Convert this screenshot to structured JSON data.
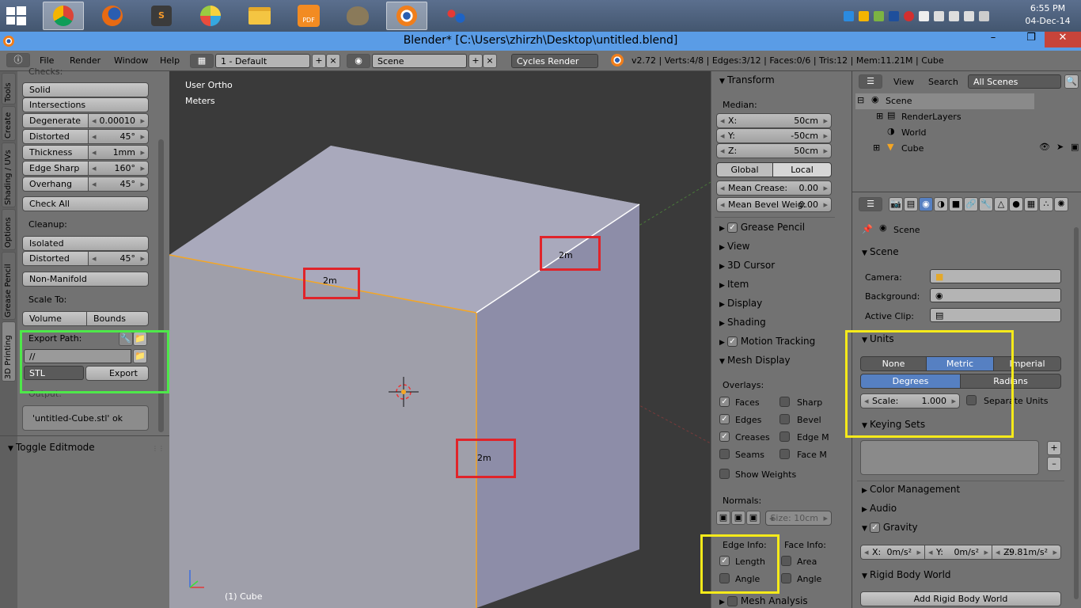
{
  "clock": {
    "time": "6:55 PM",
    "date": "04-Dec-14"
  },
  "window": {
    "title": "Blender* [C:\\Users\\zhirzh\\Desktop\\untitled.blend]"
  },
  "menu": {
    "items": [
      "File",
      "Render",
      "Window",
      "Help"
    ],
    "layout": "1 - Default",
    "scene": "Scene",
    "engine": "Cycles Render",
    "stats": "v2.72 | Verts:4/8 | Edges:3/12 | Faces:0/6 | Tris:12 | Mem:11.21M | Cube"
  },
  "left_tabs": [
    "Tools",
    "Create",
    "Shading / UVs",
    "Options",
    "Grease Pencil",
    "3D Printing"
  ],
  "toolshelf": {
    "checks_label": "Checks:",
    "solid": "Solid",
    "intersections": "Intersections",
    "degenerate": "Degenerate",
    "degenerate_val": "0.00010",
    "distorted": "Distorted",
    "distorted_val": "45°",
    "thickness": "Thickness",
    "thickness_val": "1mm",
    "edge_sharp": "Edge Sharp",
    "edge_sharp_val": "160°",
    "overhang": "Overhang",
    "overhang_val": "45°",
    "check_all": "Check All",
    "cleanup": "Cleanup:",
    "isolated": "Isolated",
    "distorted2": "Distorted",
    "distorted2_val": "45°",
    "non_manifold": "Non-Manifold",
    "scale_to": "Scale To:",
    "volume": "Volume",
    "bounds": "Bounds",
    "export_path": "Export Path:",
    "path_val": "//",
    "format": "STL",
    "export": "Export",
    "output": "Output:",
    "output_msg": "'untitled-Cube.stl' ok",
    "toggle_editmode": "Toggle Editmode"
  },
  "viewport": {
    "view_name": "User Ortho",
    "units": "Meters",
    "object": "(1) Cube",
    "dim_labels": [
      "2m",
      "2m",
      "2m"
    ]
  },
  "props": {
    "transform": "Transform",
    "median": "Median:",
    "x_label": "X:",
    "x_val": "50cm",
    "y_label": "Y:",
    "y_val": "-50cm",
    "z_label": "Z:",
    "z_val": "50cm",
    "global": "Global",
    "local": "Local",
    "mean_crease": "Mean Crease:",
    "mean_crease_val": "0.00",
    "mean_bevel": "Mean Bevel Weig:",
    "mean_bevel_val": "0.00",
    "grease_pencil": "Grease Pencil",
    "view": "View",
    "cursor": "3D Cursor",
    "item": "Item",
    "display": "Display",
    "shading": "Shading",
    "motion_tracking": "Motion Tracking",
    "mesh_display": "Mesh Display",
    "overlays": "Overlays:",
    "faces": "Faces",
    "sharp": "Sharp",
    "edges": "Edges",
    "bevel": "Bevel",
    "creases": "Creases",
    "edge_m": "Edge M",
    "seams": "Seams",
    "face_m": "Face M",
    "show_weights": "Show Weights",
    "normals": "Normals:",
    "size": "Size: 10cm",
    "edge_info": "Edge Info:",
    "face_info": "Face Info:",
    "length": "Length",
    "area": "Area",
    "angle": "Angle",
    "angle2": "Angle",
    "mesh_analysis": "Mesh Analysis"
  },
  "outliner": {
    "view": "View",
    "search": "Search",
    "filter": "All Scenes",
    "items": [
      "Scene",
      "RenderLayers",
      "World",
      "Cube"
    ]
  },
  "properties": {
    "breadcrumb": "Scene",
    "scene_hdr": "Scene",
    "camera": "Camera:",
    "background": "Background:",
    "active_clip": "Active Clip:",
    "units_hdr": "Units",
    "none": "None",
    "metric": "Metric",
    "imperial": "Imperial",
    "degrees": "Degrees",
    "radians": "Radians",
    "scale_label": "Scale:",
    "scale_val": "1.000",
    "separate_units": "Separate Units",
    "keying_sets": "Keying Sets",
    "color_mgmt": "Color Management",
    "audio": "Audio",
    "gravity": "Gravity",
    "gx_label": "X:",
    "gx": "0m/s²",
    "gy_label": "Y:",
    "gy": "0m/s²",
    "gz_label": "Z:",
    "gz": "-9.81m/s²",
    "rigid_body": "Rigid Body World",
    "add_rigid": "Add Rigid Body World"
  },
  "colors": {
    "highlight_red": "#e0242a",
    "highlight_green": "#4ee84a",
    "highlight_yellow": "#f5ea1a",
    "selected_blue": "#5680c2",
    "edge_orange": "#f5a623"
  }
}
